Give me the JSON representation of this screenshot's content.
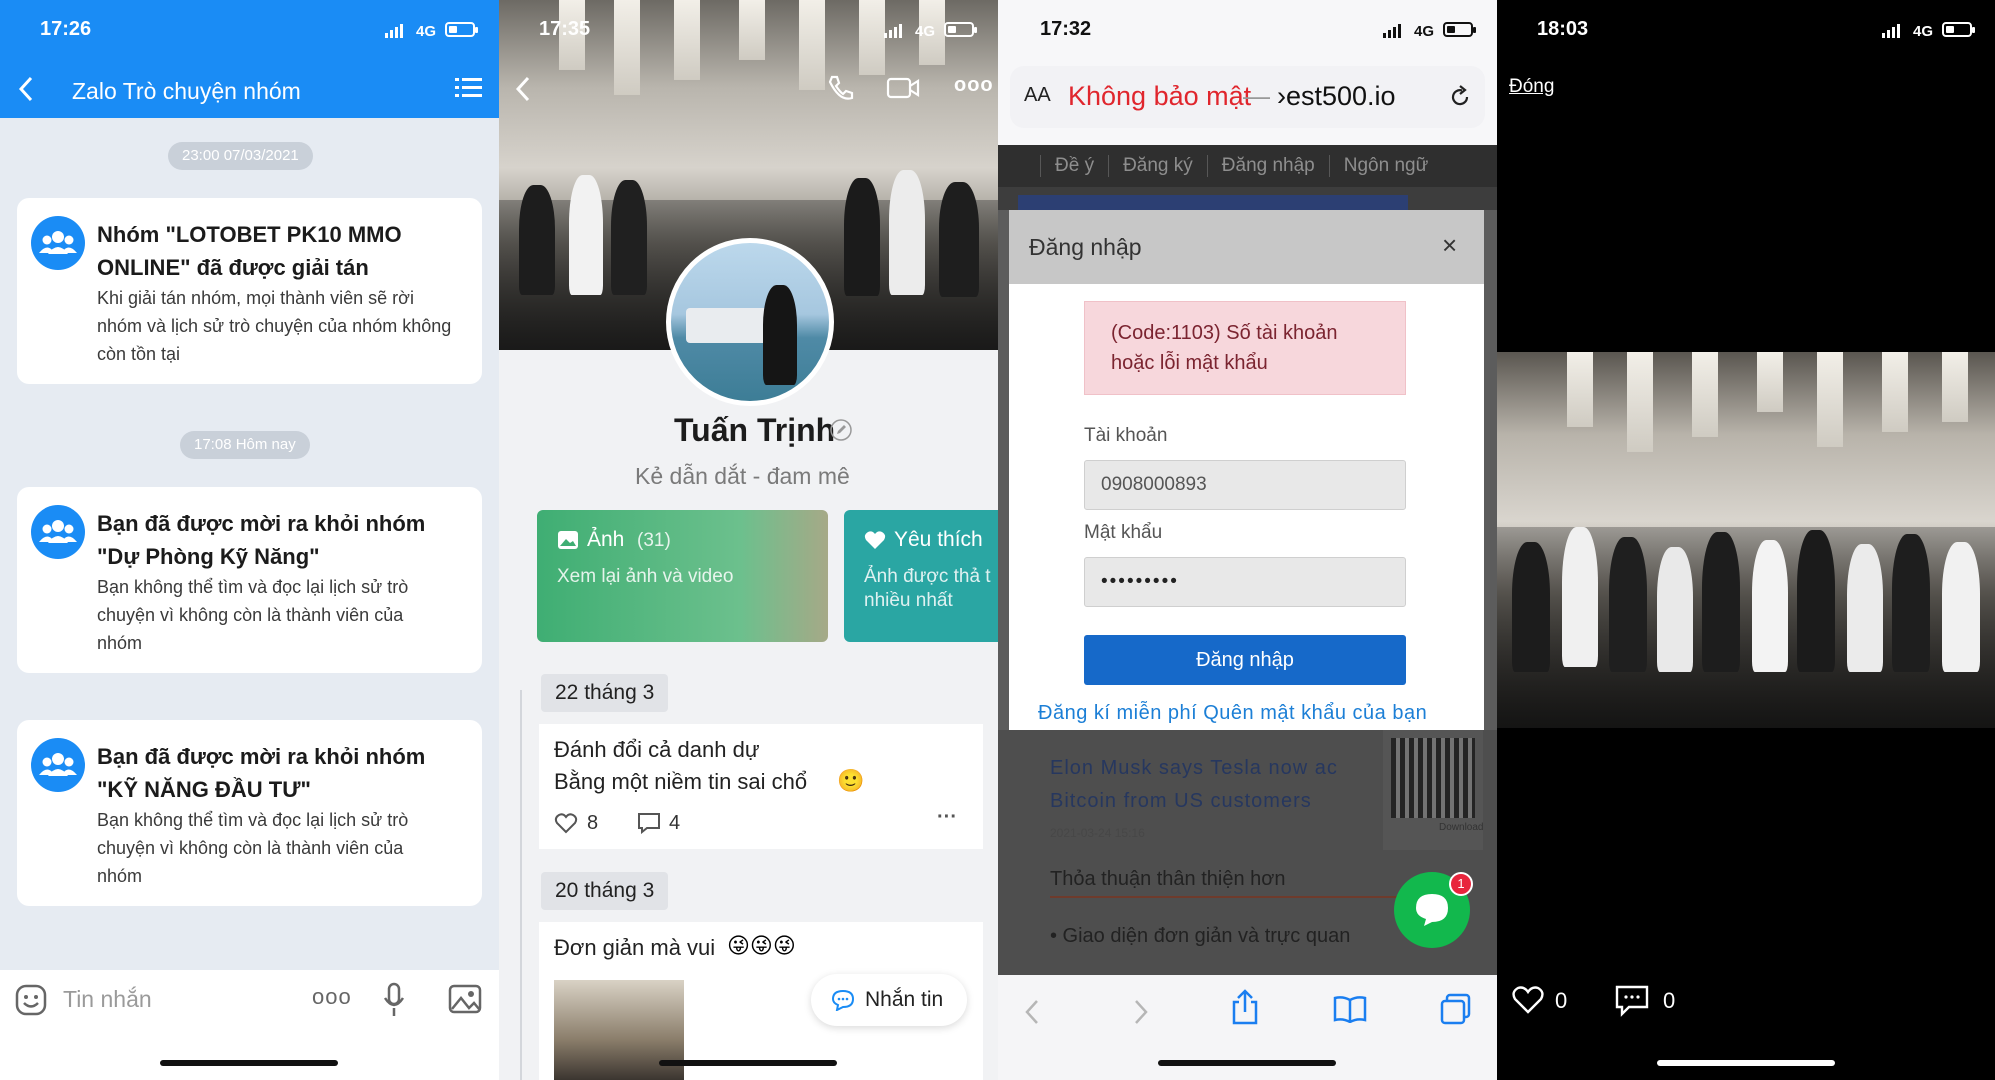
{
  "panel1": {
    "time": "17:26",
    "network": "4G",
    "header_title": "Zalo Trò chuyện nhóm",
    "timestamps": [
      "23:00 07/03/2021",
      "17:08 Hôm nay"
    ],
    "messages": [
      {
        "title": "Nhóm \"LOTOBET PK10 MMO ONLINE\" đã được giải tán",
        "body": "Khi giải tán nhóm, mọi thành viên sẽ rời nhóm và lịch sử trò chuyện của nhóm không còn tồn tại"
      },
      {
        "title": "Bạn đã được mời ra khỏi nhóm \"Dự Phòng Kỹ Năng\"",
        "body": "Bạn không thể tìm và đọc lại lịch sử trò chuyện vì không còn là thành viên của nhóm"
      },
      {
        "title": "Bạn đã được mời ra khỏi nhóm \"KỸ NĂNG ĐẦU TƯ\"",
        "body": "Bạn không thể tìm và đọc lại lịch sử trò chuyện vì không còn là thành viên của nhóm"
      }
    ],
    "input_placeholder": "Tin nhắn",
    "more_label": "ooo"
  },
  "panel2": {
    "time": "17:35",
    "network": "4G",
    "more_label": "ooo",
    "name": "Tuấn Trịnh",
    "bio": "Kẻ dẫn dắt - đam mê",
    "photos_tile": {
      "title": "Ảnh",
      "count": "(31)",
      "subtitle": "Xem lại ảnh và video"
    },
    "likes_tile": {
      "title": "Yêu thích",
      "subtitle_line1": "Ảnh được thả t",
      "subtitle_line2": "nhiều nhất"
    },
    "posts": [
      {
        "date": "22 tháng 3",
        "line1": "Đánh đổi cả danh dự",
        "line2": "Bằng một niềm tin sai chổ",
        "emoji": "🙂",
        "likes": "8",
        "comments": "4"
      },
      {
        "date": "20 tháng 3",
        "line1": "Đơn giản mà vui",
        "emoji": "😜😜😜"
      }
    ],
    "message_button": "Nhắn tin"
  },
  "panel3": {
    "time": "17:32",
    "network": "4G",
    "text_size_label": "AA",
    "url_warning": "Không bảo mật",
    "url_separator": "—",
    "url_domain": "›est500.io",
    "nav_items": [
      "Đề ý",
      "Đăng ký",
      "Đăng nhập",
      "Ngôn ngữ"
    ],
    "modal_title": "Đăng nhập",
    "error_line1": "(Code:1103) Số tài khoản",
    "error_line2": "hoặc lỗi mật khẩu",
    "account_label": "Tài khoản",
    "account_value": "0908000893",
    "password_label": "Mật khẩu",
    "password_value": "•••••••••",
    "login_button": "Đăng nhập",
    "footer_links": "Đăng kí miễn phí Quên mật khẩu của bạn",
    "news_line1": "Elon Musk says Tesla now ac",
    "news_line2": "Bitcoin from US customers",
    "news_date": "2021-03-24 15:16",
    "qr_caption": "Download",
    "section_title": "Thỏa thuận thân thiện hơn",
    "bullet": "• Giao diện đơn giản và trực quan",
    "chat_badge": "1"
  },
  "panel4": {
    "time": "18:03",
    "network": "4G",
    "close_label": "Đóng",
    "likes": "0",
    "comments": "0"
  },
  "colors": {
    "zalo_blue": "#1a8cf5",
    "danger_red": "#e0262d",
    "login_blue": "#1669c9",
    "chat_green": "#12b84d"
  }
}
